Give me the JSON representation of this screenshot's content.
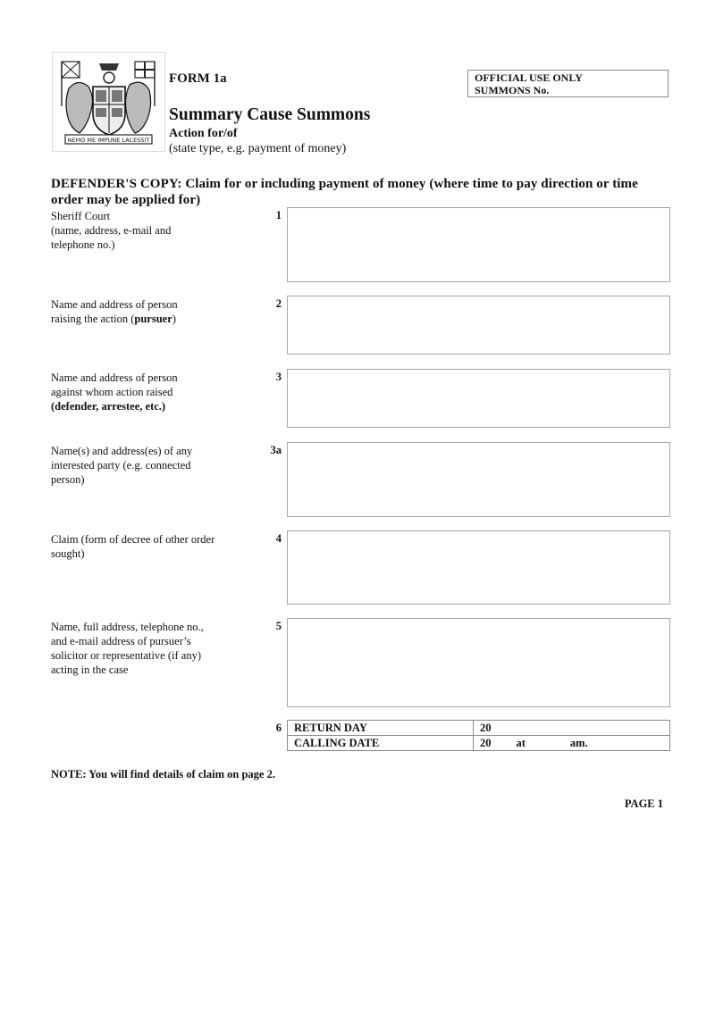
{
  "header": {
    "crest_icon": "royal-coat-of-arms",
    "crest_motto": "NEMO ME IMPUNE LACESSIT",
    "form_number": "FORM 1a",
    "title": "Summary Cause Summons",
    "action_label": "Action for/of",
    "action_hint": "(state type, e.g. payment of money)",
    "official_use": {
      "line1": "OFFICIAL USE ONLY",
      "line2": "SUMMONS No."
    }
  },
  "copy_heading": "DEFENDER'S COPY: Claim for or including payment of money (where time to pay direction or time order may be applied for)",
  "fields": [
    {
      "number": "1",
      "label_lines": [
        "Sheriff Court",
        "(name, address, e-mail and",
        "telephone no.)"
      ],
      "value": ""
    },
    {
      "number": "2",
      "label_plain": "Name and address of person raising the action (",
      "label_bold": "pursuer",
      "label_end": ")",
      "value": ""
    },
    {
      "number": "3",
      "label_plain": "Name and address of person against whom action raised",
      "label_bold": "(defender, arrestee, etc.)",
      "value": ""
    },
    {
      "number": "3a",
      "label": "Name(s) and address(es) of any interested party (e.g. connected person)",
      "value": ""
    },
    {
      "number": "4",
      "label": "Claim (form of decree of other order sought)",
      "value": ""
    },
    {
      "number": "5",
      "label": "Name, full address, telephone no., and e-mail address of pursuer’s solicitor or representative (if any) acting in the case",
      "value": ""
    }
  ],
  "dates": {
    "number": "6",
    "return_day_label": "RETURN DAY",
    "return_day_year": "20",
    "calling_date_label": "CALLING DATE",
    "calling_date_year": "20",
    "at_label": "at",
    "am_label": "am."
  },
  "note": "NOTE: You will find details of claim on page 2.",
  "page_label": "PAGE 1"
}
